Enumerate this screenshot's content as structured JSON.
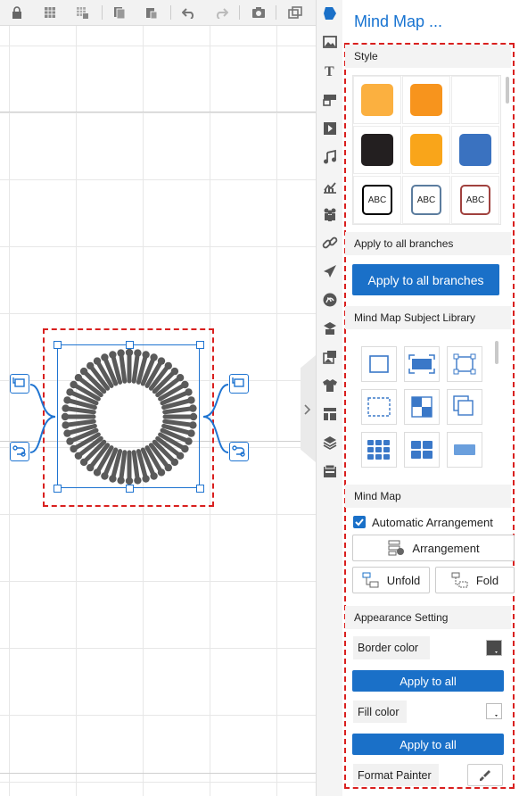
{
  "panel": {
    "title": "Mind Map ...",
    "sections": {
      "style": "Style",
      "apply_all": "Apply to all branches",
      "library": "Mind Map Subject Library",
      "mindmap": "Mind Map",
      "appearance": "Appearance Setting"
    },
    "swatches": [
      {
        "color": "#fbb040"
      },
      {
        "color": "#f7941d"
      },
      {
        "color": ""
      },
      {
        "color": "#231f20"
      },
      {
        "color": "#f9a51a"
      },
      {
        "color": "#3a72c0"
      },
      {
        "text": "ABC",
        "border": "#000000"
      },
      {
        "text": "ABC",
        "border": "#5b7c9e"
      },
      {
        "text": "ABC",
        "border": "#a0413e"
      }
    ],
    "apply_branches_button": "Apply to all branches",
    "auto_arrangement": {
      "label": "Automatic Arrangement",
      "checked": true
    },
    "arrangement_button": "Arrangement",
    "unfold_button": "Unfold",
    "fold_button": "Fold",
    "border_color_label": "Border color",
    "fill_color_label": "Fill color",
    "apply_all_label": "Apply to all",
    "format_painter_label": "Format Painter"
  },
  "colors": {
    "accent": "#1a70c8",
    "selection_dash": "#d9201f",
    "border_chip": "#4a4a4a"
  },
  "toolbar_icons": [
    "lock-icon",
    "grid-icon",
    "grid-lock-icon",
    "copy-icon",
    "paste-icon",
    "undo-icon",
    "redo-icon",
    "camera-icon",
    "window-icon"
  ],
  "sidebar_icons": [
    "shape-icon",
    "image-icon",
    "text-icon",
    "note-icon",
    "video-icon",
    "music-icon",
    "chart-icon",
    "people-icon",
    "link-icon",
    "plane-icon",
    "swirl-icon",
    "stack-icon",
    "picture-frame-icon",
    "shirt-icon",
    "layout-icon",
    "layers-icon",
    "tray-icon"
  ]
}
